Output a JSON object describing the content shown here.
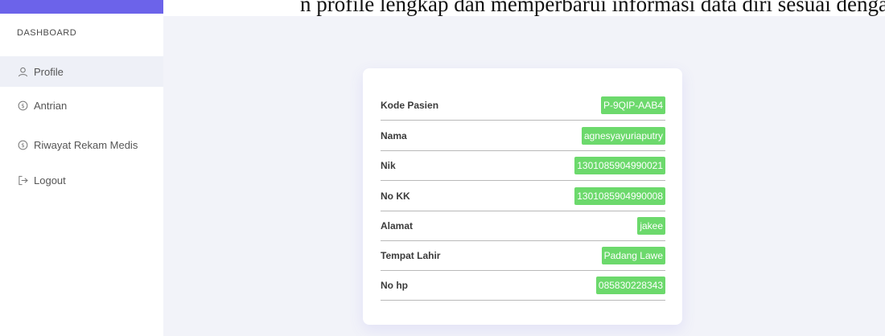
{
  "header": {
    "overflow_text": "n profile lengkap dan memperbarui informasi data diri sesuai dengan",
    "accent_color": "#6c63ea"
  },
  "sidebar": {
    "brand": "DASHBOARD",
    "items": [
      {
        "label": "Profile",
        "icon": "user-icon",
        "active": true
      },
      {
        "label": "Antrian",
        "icon": "dollar-circle-icon",
        "active": false
      },
      {
        "label": "Riwayat Rekam Medis",
        "icon": "dollar-circle-icon",
        "active": false
      },
      {
        "label": "Logout",
        "icon": "logout-icon",
        "active": false
      }
    ]
  },
  "profile": {
    "fields": [
      {
        "label": "Kode Pasien",
        "value": "P-9QIP-AAB4"
      },
      {
        "label": "Nama",
        "value": "agnesyayuriaputry"
      },
      {
        "label": "Nik",
        "value": "1301085904990021"
      },
      {
        "label": "No KK",
        "value": "1301085904990008"
      },
      {
        "label": "Alamat",
        "value": "jakee"
      },
      {
        "label": "Tempat Lahir",
        "value": "Padang Lawe"
      },
      {
        "label": "No hp",
        "value": "085830228343"
      }
    ],
    "badge_color": "#6cd96c"
  }
}
